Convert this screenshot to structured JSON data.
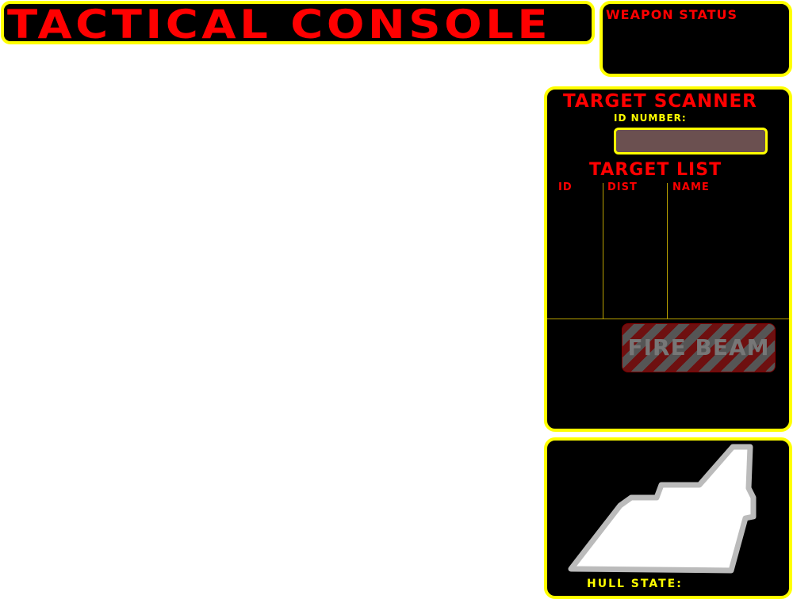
{
  "header": {
    "title": "TACTICAL CONSOLE"
  },
  "weapon_status": {
    "title": "WEAPON STATUS"
  },
  "target_scanner": {
    "title": "TARGET SCANNER",
    "id_label": "ID NUMBER:",
    "id_value": "",
    "list_title": "TARGET LIST",
    "columns": [
      "ID",
      "DIST",
      "NAME"
    ],
    "rows": [],
    "fire_button_label": "FIRE BEAM",
    "fire_button_enabled": false
  },
  "hull": {
    "label": "HULL STATE:",
    "diagram_icon": "ship-hull-icon"
  },
  "colors": {
    "panel_bg": "#000000",
    "border": "#ffff00",
    "title_text": "#ff0000",
    "label_text": "#ffff00",
    "input_bg": "#6b5050",
    "hull_fill": "#ffffff",
    "hull_outline": "#bbbbbb"
  }
}
